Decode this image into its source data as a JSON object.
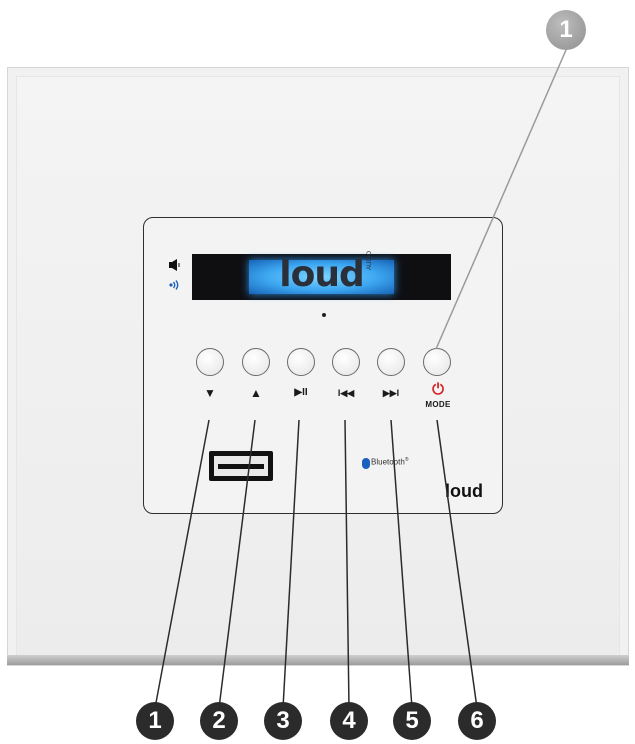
{
  "display": {
    "logo_text": "loud",
    "logo_sub": "AUDIO"
  },
  "buttons": [
    {
      "id": "down",
      "label": "▼"
    },
    {
      "id": "up",
      "label": "▲"
    },
    {
      "id": "play-pause",
      "label": "▶II"
    },
    {
      "id": "previous",
      "label": "I◀◀"
    },
    {
      "id": "next",
      "label": "▶▶I"
    },
    {
      "id": "mode",
      "label": "⏻"
    }
  ],
  "mode_label": "MODE",
  "bluetooth_label": "Bluetooth",
  "bluetooth_mark": "®",
  "brand": "loud",
  "callouts": [
    "1",
    "2",
    "3",
    "4",
    "5",
    "6"
  ],
  "top_callout": "1",
  "colors": {
    "power_red": "#d3262a",
    "bluetooth_blue": "#1b5fbf",
    "lcd_backlight": "#3ca6f0"
  },
  "icons": {
    "speaker": "speaker-icon",
    "bt_signal": "bluetooth-signal-icon",
    "power": "power-icon"
  }
}
